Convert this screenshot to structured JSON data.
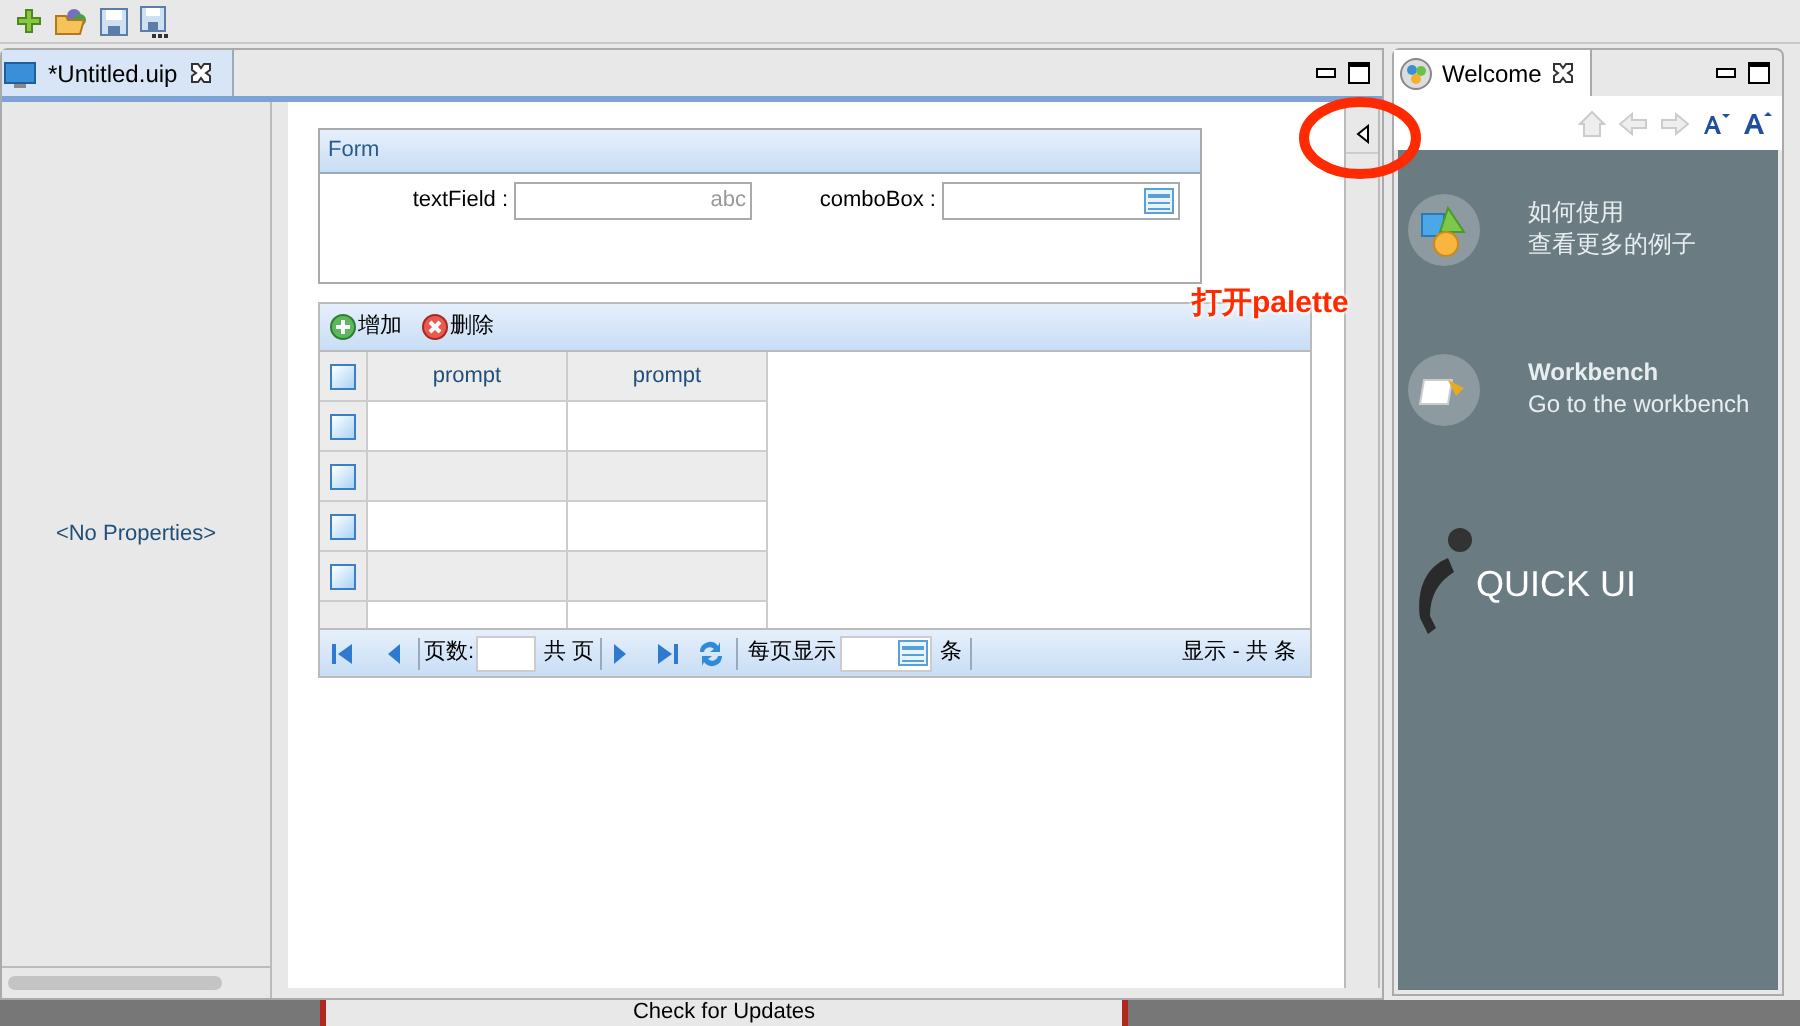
{
  "editor": {
    "tab": {
      "title": "*Untitled.uip",
      "selected": true
    }
  },
  "properties": {
    "empty_text": "<No Properties>"
  },
  "form": {
    "title": "Form",
    "fields": [
      {
        "kind": "text",
        "label": "textField :",
        "placeholder": "abc"
      },
      {
        "kind": "combo",
        "label": "comboBox :"
      }
    ]
  },
  "grid": {
    "toolbar": [
      {
        "kind": "add",
        "label": "增加"
      },
      {
        "kind": "delete",
        "label": "删除"
      }
    ],
    "select_all": {
      "checked": false
    },
    "columns": [
      "prompt",
      "prompt"
    ],
    "rows": [
      {
        "checked": false
      },
      {
        "checked": false
      },
      {
        "checked": false
      },
      {
        "checked": false
      }
    ],
    "pager": {
      "page_label": "页数:",
      "total_pages": "共 页",
      "page_size_label": "每页显示",
      "page_size_unit": "条",
      "summary": "显示 - 共 条"
    }
  },
  "annotation": {
    "text": "打开palette"
  },
  "welcome": {
    "tab": {
      "title": "Welcome",
      "selected": true
    },
    "links": [
      {
        "kind": "samples",
        "title": "如何使用",
        "subtitle": "查看更多的例子"
      },
      {
        "kind": "workbench",
        "title": "Workbench",
        "subtitle": "Go to the workbench"
      }
    ],
    "logo": "QUICK UI"
  },
  "background": {
    "button": "Check for Updates"
  }
}
